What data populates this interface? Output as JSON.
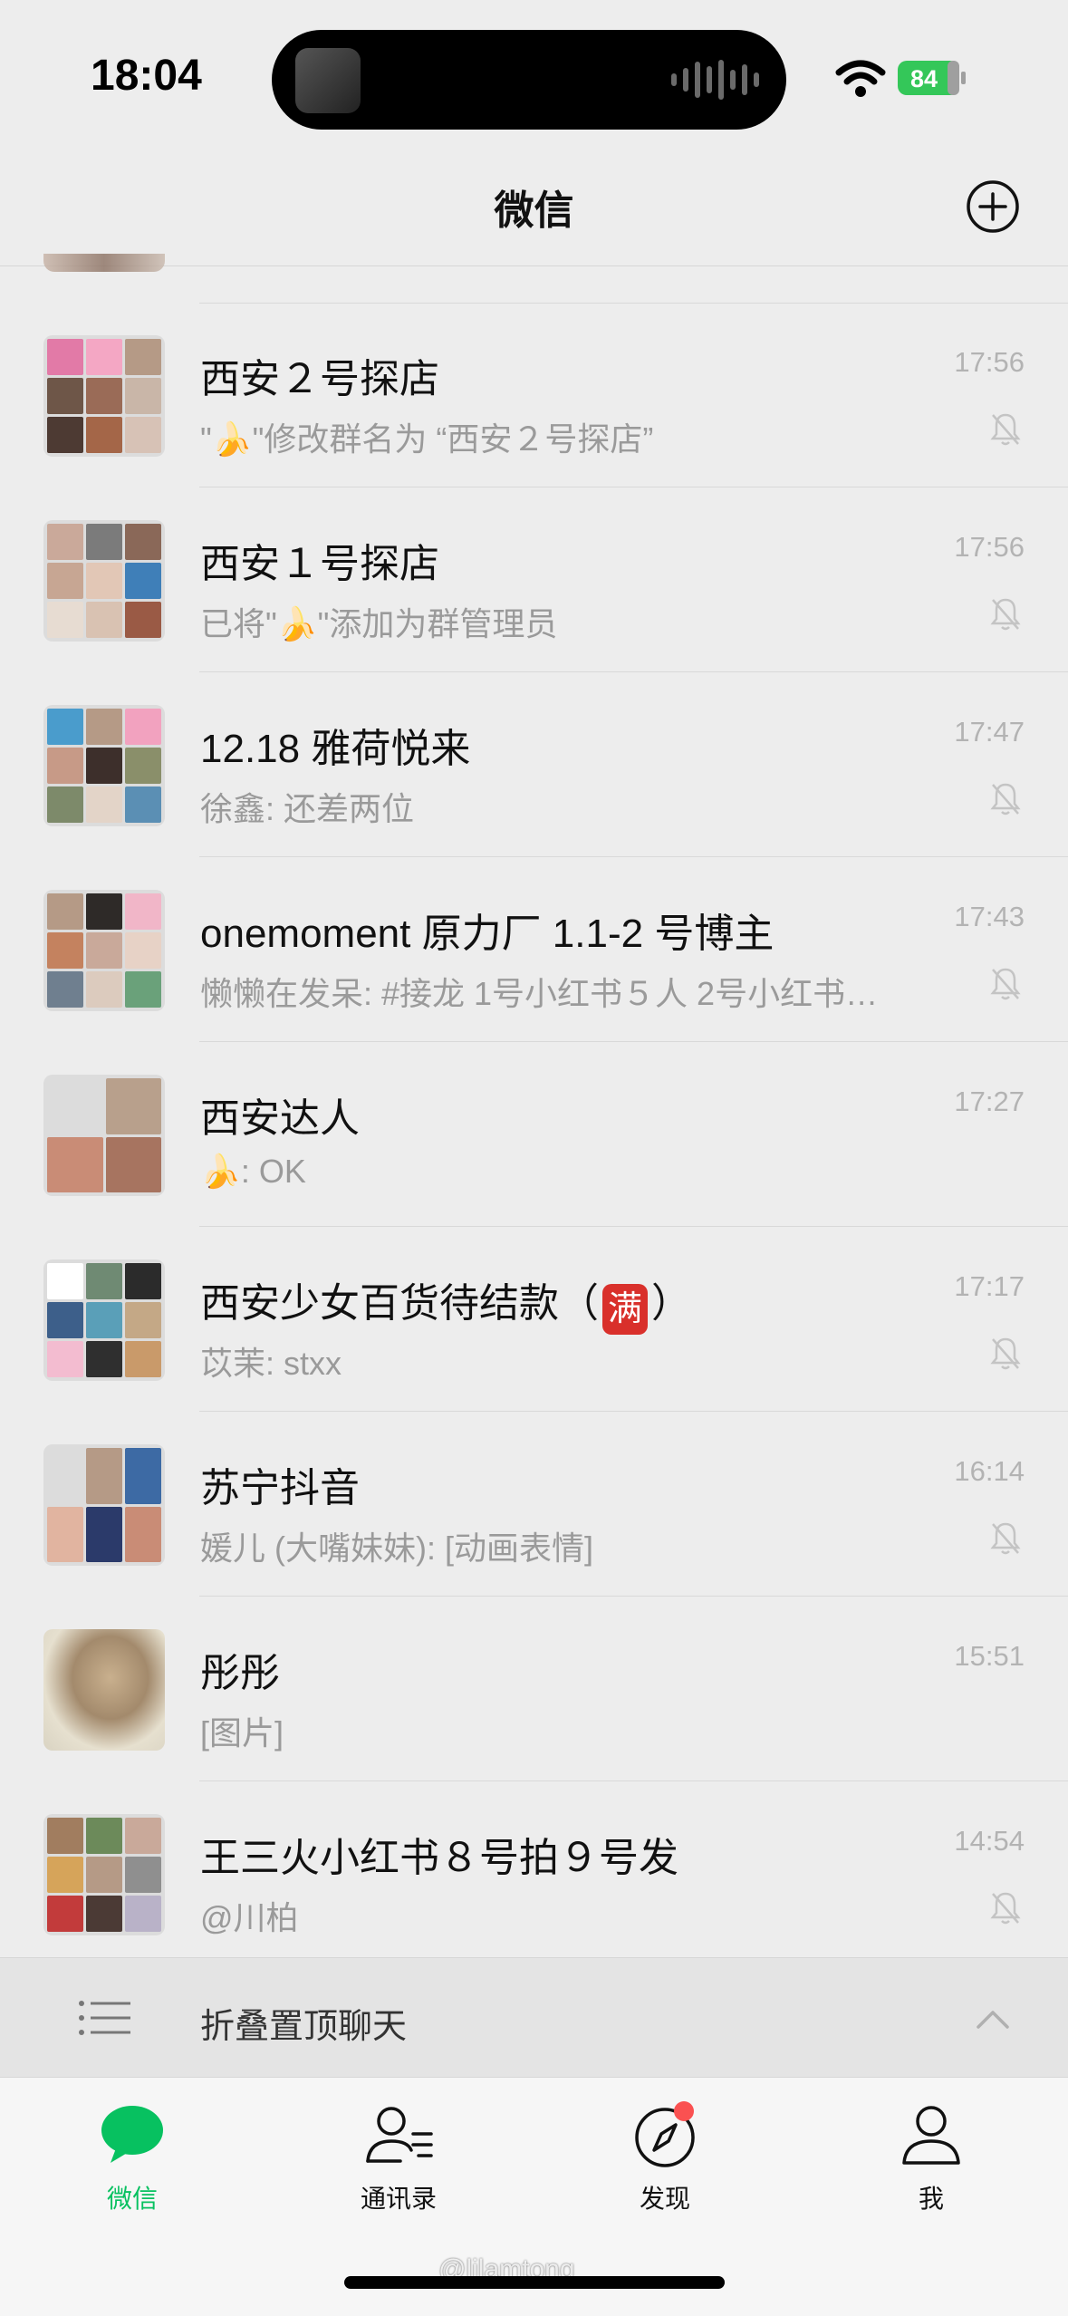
{
  "status_bar": {
    "time": "18:04",
    "battery": "84"
  },
  "header": {
    "title": "微信"
  },
  "colors": {
    "accent": "#07c160",
    "background": "#ededed",
    "badge_red": "#fa5151",
    "full_badge": "#d9302b"
  },
  "chats": [
    {
      "name": "西安２号探店",
      "preview": "\"🍌\"修改群名为 “西安２号探店”",
      "time": "17:56",
      "muted": true
    },
    {
      "name": "西安１号探店",
      "preview": "已将\"🍌\"添加为群管理员",
      "time": "17:56",
      "muted": true
    },
    {
      "name": "12.18 雅荷悦来",
      "preview": "徐鑫: 还差两位",
      "time": "17:47",
      "muted": true
    },
    {
      "name": "onemoment 原力厂 1.1-2 号博主",
      "preview": "懒懒在发呆: #接龙 1号小红书５人 2号小红书…",
      "time": "17:43",
      "muted": true
    },
    {
      "name": "西安达人",
      "preview": "🍌: OK",
      "time": "17:27",
      "muted": false
    },
    {
      "name_prefix": "西安少女百货待结款（",
      "name_badge": "满",
      "name_suffix": "）",
      "preview": "苡茉: stxx",
      "time": "17:17",
      "muted": true
    },
    {
      "name": "苏宁抖音",
      "preview": "媛儿 (大嘴妹妹): [动画表情]",
      "time": "16:14",
      "muted": true
    },
    {
      "name": "彤彤",
      "preview": "[图片]",
      "time": "15:51",
      "muted": false
    },
    {
      "name": "王三火小红书８号拍９号发",
      "preview": "@川柏",
      "time": "14:54",
      "muted": true
    }
  ],
  "fold_bar": {
    "label": "折叠置顶聊天"
  },
  "tabs": [
    {
      "label": "微信",
      "icon": "chat-bubble-icon",
      "active": true
    },
    {
      "label": "通讯录",
      "icon": "contacts-icon",
      "active": false
    },
    {
      "label": "发现",
      "icon": "compass-icon",
      "active": false,
      "badge_dot": true
    },
    {
      "label": "我",
      "icon": "person-icon",
      "active": false
    }
  ],
  "watermark": "@lilamtong"
}
